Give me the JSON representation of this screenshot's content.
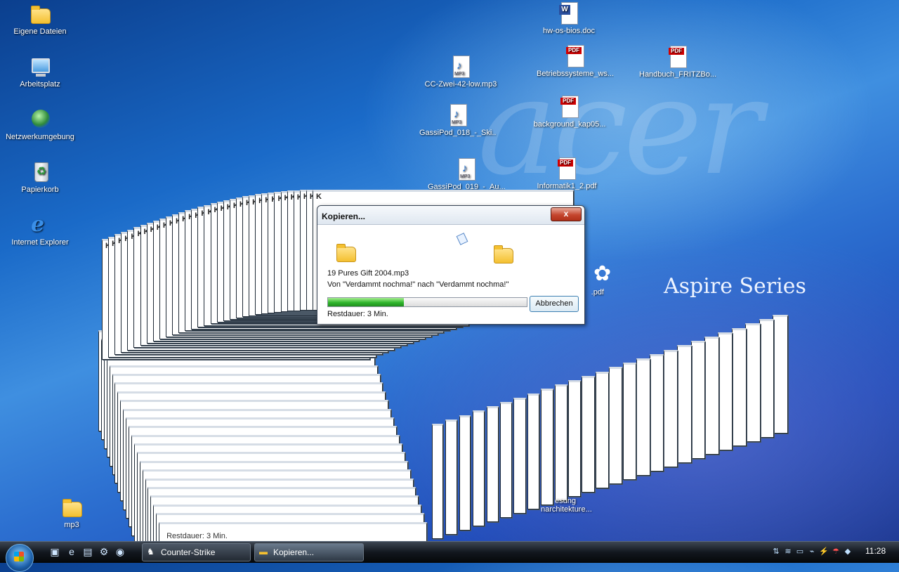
{
  "desktop": {
    "left_icons": [
      {
        "label": "Eigene Dateien",
        "icon": "folder-documents-icon"
      },
      {
        "label": "Arbeitsplatz",
        "icon": "computer-icon"
      },
      {
        "label": "Netzwerkumgebung",
        "icon": "network-icon"
      },
      {
        "label": "Papierkorb",
        "icon": "recycle-bin-icon"
      },
      {
        "label": "Internet Explorer",
        "icon": "internet-explorer-icon"
      }
    ],
    "files": [
      {
        "label": "hw-os-bios.doc",
        "type": "W"
      },
      {
        "label": "Betriebssysteme_ws...",
        "type": "PDF"
      },
      {
        "label": "Handbuch_FRITZBo...",
        "type": "PDF"
      },
      {
        "label": "CC-Zwei-42-low.mp3",
        "type": "MP3"
      },
      {
        "label": "background_kap05...",
        "type": "PDF"
      },
      {
        "label": "GassiPod_018_-_Ski...",
        "type": "MP3"
      },
      {
        "label": "GassiPod_019_-_Au...",
        "type": "MP3"
      },
      {
        "label": "Informatik1_2.pdf",
        "type": "PDF"
      },
      {
        "label": ".pdf",
        "type": ""
      },
      {
        "label": "mp3",
        "type": "folder"
      }
    ],
    "partial_labels": {
      "p1": "esung",
      "p2": "narchitekture..."
    },
    "brand": "Aspire Series",
    "watermark": "acer"
  },
  "dialog": {
    "title": "Kopieren...",
    "close_glyph": "x",
    "file_name": "19 Pures Gift 2004.mp3",
    "from_to": "Von \"Verdammt nochma!\" nach \"Verdammt nochma!\"",
    "progress_fraction": 0.38,
    "remaining": "Restdauer: 3 Min.",
    "cancel_label": "Abbrechen"
  },
  "ghost_windows": {
    "title_glyph": "K",
    "remaining": "Restdauer: 3 Min."
  },
  "taskbar": {
    "quick_launch": [
      "desktop-icon",
      "ie-icon",
      "media-icon",
      "settings-icon",
      "firefox-icon"
    ],
    "tasks": [
      {
        "label": "Counter-Strike",
        "icon": "counter-strike-icon"
      },
      {
        "label": "Kopieren...",
        "icon": "folder-icon"
      }
    ],
    "clock": "11:28"
  }
}
